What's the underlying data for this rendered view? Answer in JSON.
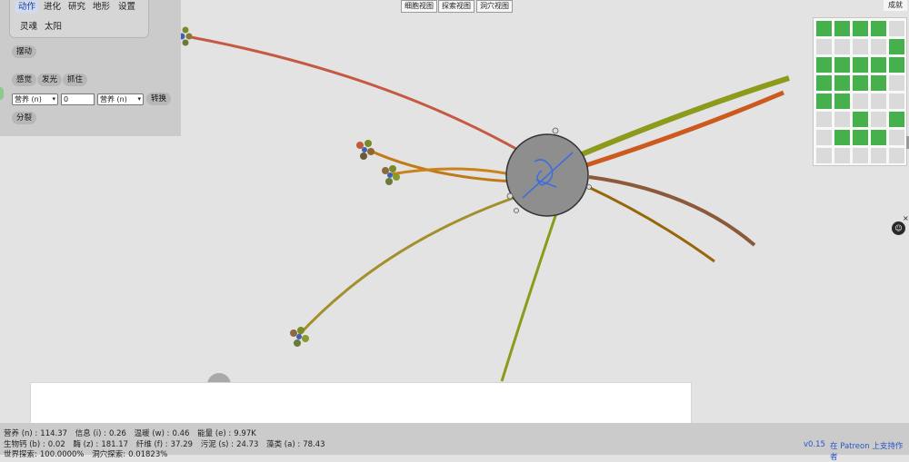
{
  "menu": {
    "tabs": [
      {
        "label": "动作",
        "active": true
      },
      {
        "label": "进化"
      },
      {
        "label": "研究"
      },
      {
        "label": "地形"
      },
      {
        "label": "设置"
      }
    ],
    "tabs2": [
      {
        "label": "灵魂"
      },
      {
        "label": "太阳"
      }
    ]
  },
  "actions": {
    "swing": "摆动",
    "sense": "感觉",
    "glow": "发光",
    "grab": "抓住",
    "convert_from": "营养 (n)",
    "convert_amount": "0",
    "convert_to": "营养 (n)",
    "convert_button": "转换",
    "divide": "分裂"
  },
  "views": [
    "细胞视图",
    "探索视图",
    "洞穴视图"
  ],
  "achievements": {
    "button": "成就",
    "cells": [
      1,
      1,
      1,
      1,
      0,
      0,
      0,
      0,
      0,
      1,
      1,
      1,
      1,
      1,
      1,
      1,
      1,
      1,
      1,
      0,
      1,
      1,
      0,
      0,
      0,
      0,
      0,
      1,
      0,
      1,
      0,
      1,
      1,
      1,
      0,
      0,
      0,
      0,
      0,
      0
    ],
    "on_color": "#46b04c",
    "off_color": "#dadada"
  },
  "stats": {
    "row1": [
      {
        "label": "营养 (n) :",
        "value": "114.37"
      },
      {
        "label": "信息 (i) :",
        "value": "0.26"
      },
      {
        "label": "温暖 (w) :",
        "value": "0.46"
      },
      {
        "label": "能量 (e) :",
        "value": "9.97K"
      }
    ],
    "row2": [
      {
        "label": "生物钙 (b) :",
        "value": "0.02"
      },
      {
        "label": "酶 (z) :",
        "value": "181.17"
      },
      {
        "label": "纤维 (f) :",
        "value": "37.29"
      },
      {
        "label": "污泥 (s) :",
        "value": "24.73"
      },
      {
        "label": "藻类 (a) :",
        "value": "78.43"
      }
    ],
    "row3": [
      {
        "label": "世界探索:",
        "value": "100.0000%"
      },
      {
        "label": "洞穴探索:",
        "value": "0.01823%"
      }
    ]
  },
  "footer": {
    "version": "v0.15",
    "patreon": "在 Patreon 上支持作者"
  },
  "colors": {
    "cell_body": "#8e8e8e",
    "nucleus": "#3f6fd8",
    "green_cell": "#46b04c",
    "link": "#2a56c6"
  }
}
